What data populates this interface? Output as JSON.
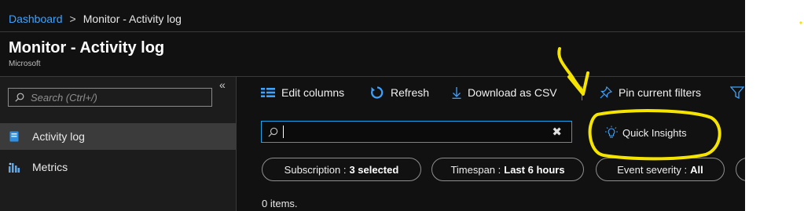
{
  "breadcrumb": {
    "root": "Dashboard",
    "separator": ">",
    "current": "Monitor - Activity log"
  },
  "header": {
    "title": "Monitor - Activity log",
    "subtitle": "Microsoft"
  },
  "sidebar": {
    "search_placeholder": "Search (Ctrl+/)",
    "collapse_glyph": "«",
    "items": [
      {
        "label": "Activity log",
        "active": true,
        "icon": "activity-log-icon"
      },
      {
        "label": "Metrics",
        "active": false,
        "icon": "metrics-icon"
      }
    ]
  },
  "toolbar": {
    "edit_columns": "Edit columns",
    "refresh": "Refresh",
    "download_csv": "Download as CSV",
    "pin_filters": "Pin current filters"
  },
  "filter": {
    "value": "",
    "clear_glyph": "✖"
  },
  "quick_insights": "Quick Insights",
  "pills": [
    {
      "label": "Subscription :",
      "value": "3 selected"
    },
    {
      "label": "Timespan :",
      "value": "Last 6 hours"
    },
    {
      "label": "Event severity :",
      "value": "All"
    }
  ],
  "items_count": "0 items.",
  "colors": {
    "link": "#3ea3ff",
    "accent": "#1aa3e8",
    "annotation": "#f5e400",
    "background": "#111111",
    "sidebar": "#1c1c1c"
  }
}
